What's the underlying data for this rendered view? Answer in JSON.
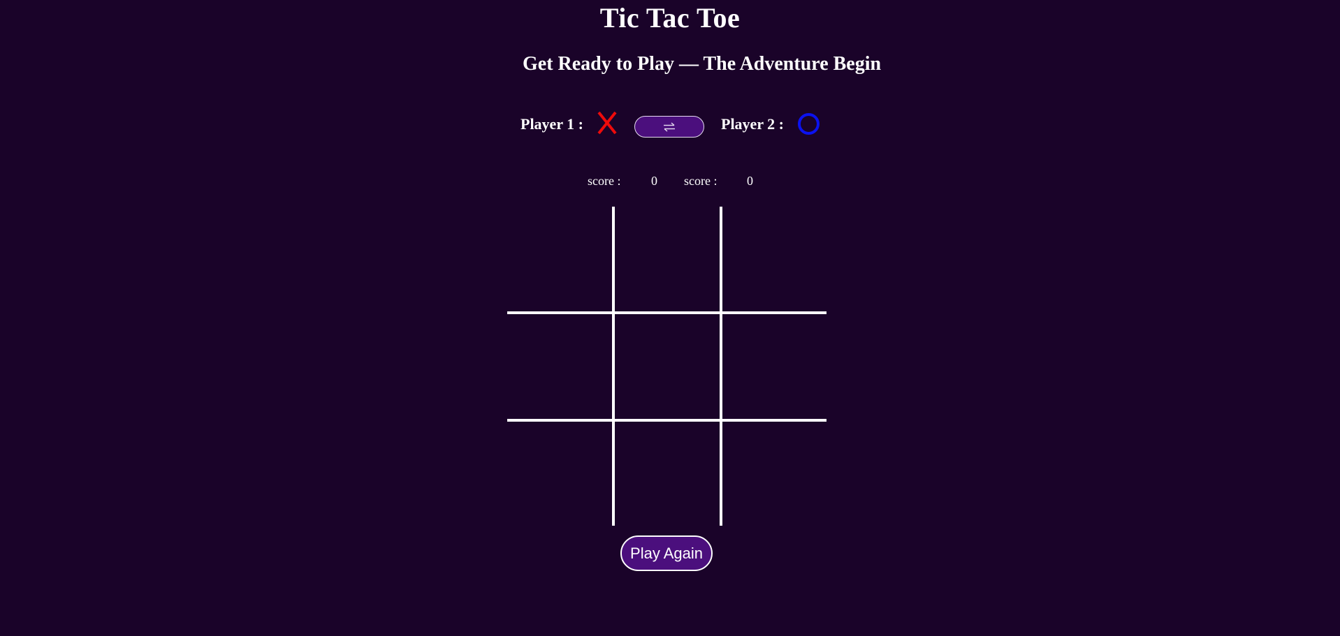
{
  "header": {
    "title": "Tic Tac Toe",
    "subtitle": "Get Ready to Play — The Adventure Begin"
  },
  "players": {
    "player1": {
      "label": "Player 1 :",
      "symbol": "X",
      "color": "#ee0b0b",
      "score_label": "score :",
      "score": "0"
    },
    "player2": {
      "label": "Player 2 :",
      "symbol": "O",
      "color": "#0b12f0",
      "score_label": "score :",
      "score": "0"
    },
    "swap_icon": "swap-arrows-icon"
  },
  "board": {
    "cells": [
      "",
      "",
      "",
      "",
      "",
      "",
      "",
      "",
      ""
    ]
  },
  "actions": {
    "play_again_label": "Play Again"
  },
  "colors": {
    "background": "#1a0329",
    "button": "#4b0f7d",
    "grid": "#ffffff"
  }
}
